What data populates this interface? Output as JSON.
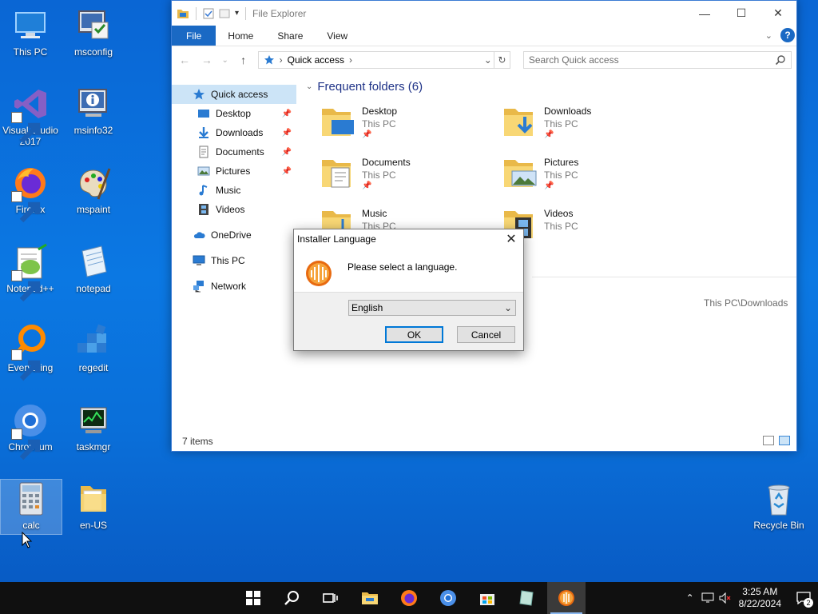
{
  "desktop": {
    "icons": [
      {
        "label": "This PC"
      },
      {
        "label": "msconfig"
      },
      {
        "label": "Visual Studio 2017"
      },
      {
        "label": "msinfo32"
      },
      {
        "label": "Firefox"
      },
      {
        "label": "mspaint"
      },
      {
        "label": "Notepad++"
      },
      {
        "label": "notepad"
      },
      {
        "label": "Everything"
      },
      {
        "label": "regedit"
      },
      {
        "label": "Chromium"
      },
      {
        "label": "taskmgr"
      },
      {
        "label": "calc"
      },
      {
        "label": "en-US"
      },
      {
        "label": "Recycle Bin"
      }
    ]
  },
  "explorer": {
    "title": "File Explorer",
    "tabs": [
      "File",
      "Home",
      "Share",
      "View"
    ],
    "address": "Quick access",
    "search_placeholder": "Search Quick access",
    "nav": {
      "quick_access": "Quick access",
      "desktop": "Desktop",
      "downloads": "Downloads",
      "documents": "Documents",
      "pictures": "Pictures",
      "music": "Music",
      "videos": "Videos",
      "onedrive": "OneDrive",
      "this_pc": "This PC",
      "network": "Network"
    },
    "section_title": "Frequent folders (6)",
    "folders": [
      {
        "name": "Desktop",
        "location": "This PC"
      },
      {
        "name": "Downloads",
        "location": "This PC"
      },
      {
        "name": "Documents",
        "location": "This PC"
      },
      {
        "name": "Pictures",
        "location": "This PC"
      },
      {
        "name": "Music",
        "location": "This PC"
      },
      {
        "name": "Videos",
        "location": "This PC"
      }
    ],
    "recent_path": "This PC\\Downloads",
    "status": "7 items"
  },
  "dialog": {
    "title": "Installer Language",
    "message": "Please select a language.",
    "selected_language": "English",
    "ok_label": "OK",
    "cancel_label": "Cancel"
  },
  "taskbar": {
    "time": "3:25 AM",
    "date": "8/22/2024",
    "notification_count": "2"
  },
  "colors": {
    "desktop_bg": "#0b78e3",
    "accent": "#1a69c4",
    "selection": "#cce4f7",
    "folder_yellow": "#f8d775"
  }
}
